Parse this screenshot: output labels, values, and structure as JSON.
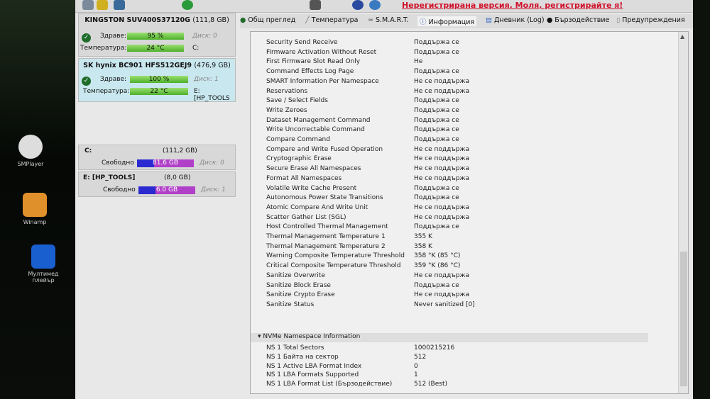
{
  "desktop": {
    "icons": [
      {
        "label": "SMPlayer"
      },
      {
        "label": "Winamp"
      },
      {
        "label": "Мултимед плейър"
      }
    ]
  },
  "header": {
    "unregistered": "Нерегистрирана версия. Моля, регистрирайте я!"
  },
  "disks": [
    {
      "name": "KINGSTON SUV400S37120G",
      "size": "(111,8 GB)",
      "health_label": "Здраве:",
      "health": "95 %",
      "health_pct": 95,
      "disk": "Диск: 0",
      "temp_label": "Температура:",
      "temp": "24 °C",
      "vol": "C:"
    },
    {
      "name": "SK hynix BC901 HFS512GEJ9",
      "size": "(476,9 GB)",
      "health_label": "Здраве:",
      "health": "100 %",
      "health_pct": 100,
      "disk": "Диск: 1",
      "temp_label": "Температура:",
      "temp": "22 °C",
      "vol": "E: [HP_TOOLS"
    }
  ],
  "volumes": [
    {
      "name": "C:",
      "size": "(111,2 GB)",
      "free_label": "Свободно",
      "free": "81.6 GB",
      "disk": "Диск: 0"
    },
    {
      "name": "E: [HP_TOOLS]",
      "size": "(8,0 GB)",
      "free_label": "Свободно",
      "free": "6.0 GB",
      "disk": "Диск: 1"
    }
  ],
  "tabs": [
    "Общ преглед",
    "Температура",
    "S.M.A.R.T.",
    "Информация",
    "Дневник (Log)",
    "Бързодействие",
    "Предупреждения"
  ],
  "rows": [
    [
      "Security Send Receive",
      "Поддържа се"
    ],
    [
      "Firmware Activation Without Reset",
      "Поддържа се"
    ],
    [
      "First Firmware Slot Read Only",
      "Не"
    ],
    [
      "Command Effects Log Page",
      "Поддържа се"
    ],
    [
      "SMART Information Per Namespace",
      "Не се поддържа"
    ],
    [
      "Reservations",
      "Не се поддържа"
    ],
    [
      "Save / Select Fields",
      "Поддържа се"
    ],
    [
      "Write Zeroes",
      "Поддържа се"
    ],
    [
      "Dataset Management Command",
      "Поддържа се"
    ],
    [
      "Write Uncorrectable Command",
      "Поддържа се"
    ],
    [
      "Compare Command",
      "Поддържа се"
    ],
    [
      "Compare and Write Fused Operation",
      "Не се поддържа"
    ],
    [
      "Cryptographic Erase",
      "Не се поддържа"
    ],
    [
      "Secure Erase All Namespaces",
      "Не се поддържа"
    ],
    [
      "Format All Namespaces",
      "Не се поддържа"
    ],
    [
      "Volatile Write Cache Present",
      "Поддържа се"
    ],
    [
      "Autonomous Power State Transitions",
      "Поддържа се"
    ],
    [
      "Atomic Compare And Write Unit",
      "Не се поддържа"
    ],
    [
      "Scatter Gather List (SGL)",
      "Не се поддържа"
    ],
    [
      "Host Controlled Thermal Management",
      "Поддържа се"
    ],
    [
      "Thermal Management Temperature 1",
      "355 K"
    ],
    [
      "Thermal Management Temperature 2",
      "358 K"
    ],
    [
      "Warning Composite Temperature Threshold",
      "358 °K (85 °C)"
    ],
    [
      "Critical Composite Temperature Threshold",
      "359 °K (86 °C)"
    ],
    [
      "Sanitize Overwrite",
      "Не се поддържа"
    ],
    [
      "Sanitize Block Erase",
      "Поддържа се"
    ],
    [
      "Sanitize Crypto Erase",
      "Не се поддържа"
    ],
    [
      "Sanitize Status",
      "Never sanitized [0]"
    ]
  ],
  "section": "NVMe Namespace Information",
  "ns_rows": [
    [
      "NS 1 Total Sectors",
      "1000215216"
    ],
    [
      "NS 1 Байта на сектор",
      "512"
    ],
    [
      "NS 1 Active LBA Format Index",
      "0"
    ],
    [
      "NS 1 LBA Formats Supported",
      "1"
    ],
    [
      "NS 1 LBA Format List (Бързодействие)",
      "512 (Best)"
    ]
  ]
}
